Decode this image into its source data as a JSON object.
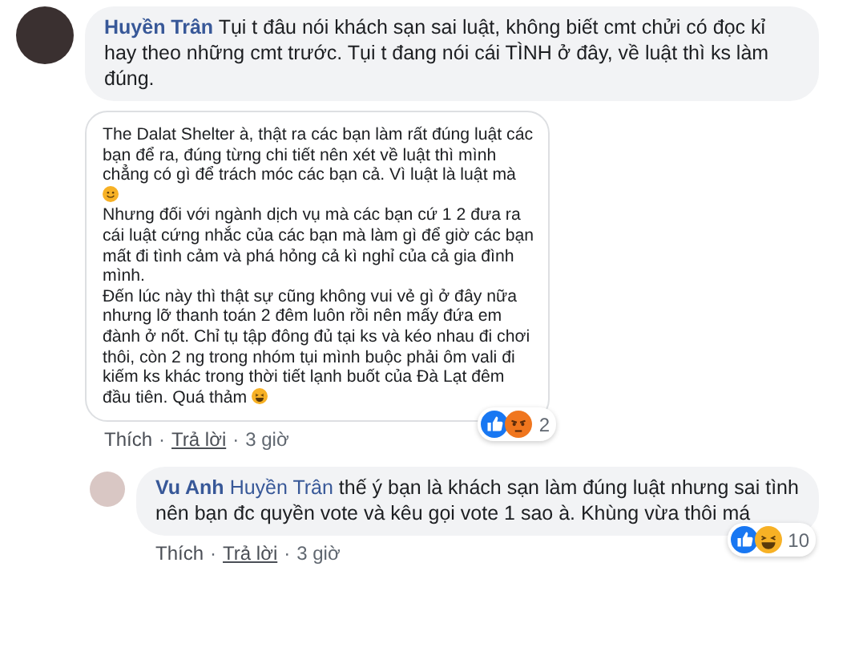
{
  "comments": [
    {
      "author": "Huyền Trân",
      "text": "Tụi t đâu nói khách sạn sai luật, không biết cmt chửi có đọc kỉ hay theo những cmt trước. Tụi t đang nói cái TÌNH ở đây, về luật thì ks làm đúng.",
      "attachment": {
        "paragraphs": [
          {
            "text": "The Dalat Shelter à, thật ra các bạn làm rất đúng luật các bạn để ra, đúng từng chi tiết nên xét về luật thì mình chẳng có gì để trách móc các bạn cả. Vì luật là luật mà",
            "emoji": {
              "kind": "smile"
            }
          },
          {
            "text": "Nhưng đối với ngành dịch vụ mà các bạn cứ 1 2 đưa ra cái luật cứng nhắc của các bạn mà làm gì để giờ các bạn mất đi tình cảm và phá hỏng cả kì nghỉ của cả gia đình mình."
          },
          {
            "text": "Đến lúc này thì thật sự cũng không vui vẻ gì ở đây nữa nhưng lỡ thanh toán 2 đêm luôn rồi nên mấy đứa em đành ở nốt. Chỉ tụ tập đông đủ tại ks và kéo nhau đi chơi thôi, còn 2 ng trong nhóm tụi mình buộc phải ôm vali đi kiếm ks khác trong thời tiết lạnh buốt của Đà Lạt đêm đầu tiên. Quá thảm",
            "emoji": {
              "kind": "laugh"
            }
          }
        ]
      },
      "reactions": {
        "icons": [
          {
            "kind": "like"
          },
          {
            "kind": "angry"
          }
        ],
        "count": "2"
      },
      "actions": {
        "like": "Thích",
        "separator_1": "·",
        "reply": "Trả lời",
        "separator_2": "·",
        "time": "3 giờ"
      },
      "replies": [
        {
          "author": "Vu Anh",
          "tag": "Huyền Trân",
          "text": "thế ý bạn là khách sạn làm đúng luật nhưng sai tình nên bạn đc quyền vote và kêu gọi vote 1 sao à. Khùng vừa thôi má",
          "reactions": {
            "icons": [
              {
                "kind": "like"
              },
              {
                "kind": "laugh"
              }
            ],
            "count": "10"
          },
          "actions": {
            "like": "Thích",
            "separator_1": "·",
            "reply": "Trả lời",
            "separator_2": "·",
            "time": "3 giờ"
          }
        }
      ]
    }
  ]
}
